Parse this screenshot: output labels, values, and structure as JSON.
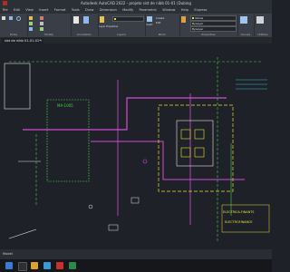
{
  "app": {
    "title": "Autodesk AutoCAD 2022 - projeto sist de nibb 01-01 (Dubing"
  },
  "menu": [
    "File",
    "Edit",
    "View",
    "Insert",
    "Format",
    "Tools",
    "Draw",
    "Dimension",
    "Modify",
    "Parametric",
    "Window",
    "Help",
    "Express"
  ],
  "ribbon": {
    "home_tab": "Home",
    "groups": [
      {
        "title": "Draw"
      },
      {
        "title": "Modify"
      },
      {
        "title": "Annotation"
      },
      {
        "title": "Layers"
      },
      {
        "title": "Block"
      },
      {
        "title": "Properties"
      },
      {
        "title": "Groups"
      },
      {
        "title": "Utilities"
      }
    ],
    "layer_properties": "Layer Properties",
    "insert": "Insert",
    "create": "Create",
    "edit": "Edit",
    "match_properties": "Match Properties",
    "bylayer": "ByLayer",
    "current_color": "Yellow",
    "group": "Group",
    "measure": "Measure"
  },
  "document": {
    "tab": "sist de nibb 01-01-01*",
    "plus": "+"
  },
  "drawing": {
    "labels": {
      "m1": "MA-1005",
      "m2": "ELECTRICA-FINANTS",
      "m3": "ELECTROFINANCE"
    },
    "colors": {
      "background": "#1e2127",
      "magenta": "#d44bd6",
      "green": "#45d14a",
      "yellow": "#e8e23a",
      "white": "#e6e6e6",
      "cyan": "#3fb6c9"
    }
  },
  "status": {
    "coords": "Model"
  }
}
